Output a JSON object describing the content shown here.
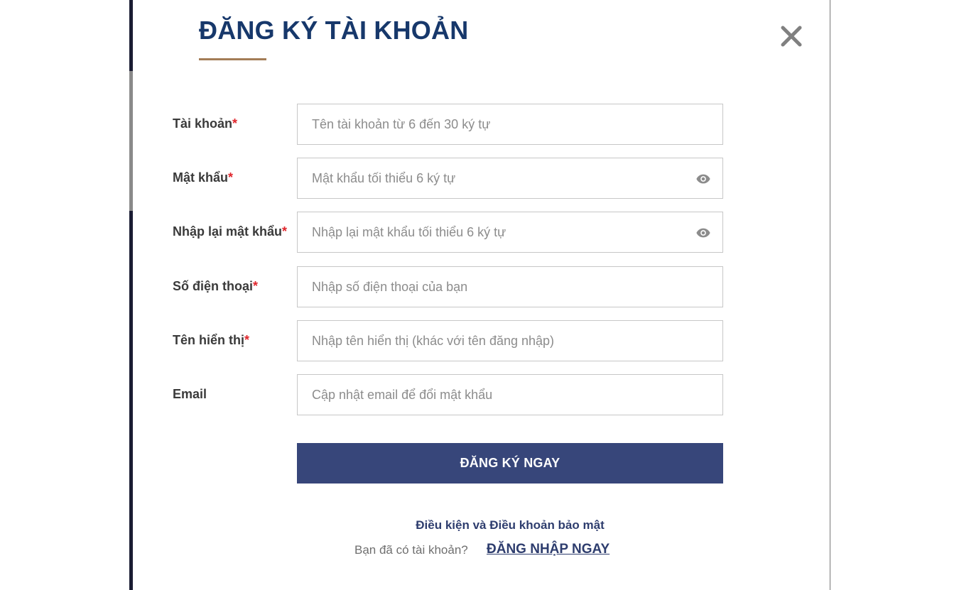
{
  "modal": {
    "title": "ĐĂNG KÝ TÀI KHOẢN",
    "close_icon": "close-icon"
  },
  "form": {
    "fields": [
      {
        "label": "Tài khoản",
        "required": "*",
        "placeholder": "Tên tài khoản từ 6 đến 30 ký tự",
        "type": "text"
      },
      {
        "label": "Mật khẩu",
        "required": "*",
        "placeholder": "Mật khẩu tối thiểu 6 ký tự",
        "type": "password",
        "icon": "eye-icon"
      },
      {
        "label": "Nhập lại mật khẩu",
        "required": "*",
        "placeholder": "Nhập lại mật khẩu tối thiểu 6 ký tự",
        "type": "password",
        "icon": "eye-icon"
      },
      {
        "label": "Số điện thoại",
        "required": "*",
        "placeholder": "Nhập số điện thoại của bạn",
        "type": "tel"
      },
      {
        "label": "Tên hiển thị",
        "required": "*",
        "placeholder": "Nhập tên hiển thị (khác với tên đăng nhập)",
        "type": "text"
      },
      {
        "label": "Email",
        "required": "",
        "placeholder": "Cập nhật email để đổi mật khẩu",
        "type": "email"
      }
    ],
    "submit_label": "ĐĂNG KÝ NGAY"
  },
  "footer": {
    "terms_link": "Điều kiện và Điều khoản bảo mật",
    "have_account_text": "Bạn đã có tài khoản?",
    "login_link": "ĐĂNG NHẬP NGAY"
  },
  "colors": {
    "title": "#17386b",
    "accent_underline": "#a37c56",
    "button": "#37467a",
    "required": "#e0262c"
  }
}
